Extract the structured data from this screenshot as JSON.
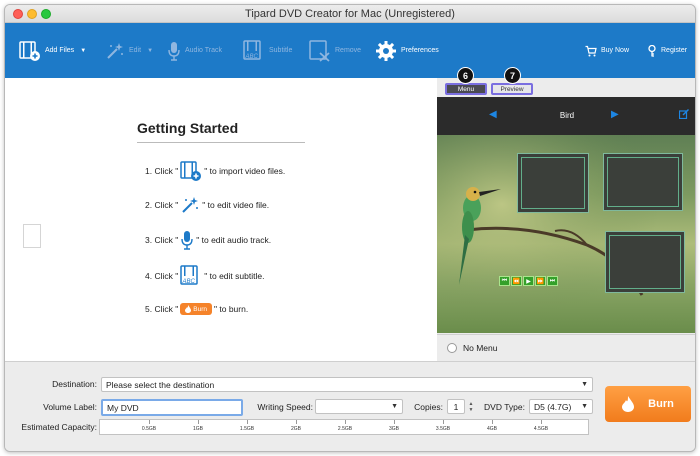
{
  "window": {
    "title": "Tipard DVD Creator for Mac (Unregistered)"
  },
  "toolbar": {
    "add_files": "Add Files",
    "edit": "Edit",
    "audio_track": "Audio Track",
    "subtitle": "Subtitle",
    "remove": "Remove",
    "preferences": "Preferences",
    "buy_now": "Buy Now",
    "register": "Register"
  },
  "getting_started": {
    "title": "Getting Started",
    "steps": [
      {
        "prefix": "1. Click \"",
        "suffix": "\" to import video files.",
        "icon": "add-video-icon"
      },
      {
        "prefix": "2. Click \"",
        "suffix": "\" to edit video file.",
        "icon": "magic-wand-icon"
      },
      {
        "prefix": "3. Click \"",
        "suffix": "\" to edit audio track.",
        "icon": "microphone-icon"
      },
      {
        "prefix": "4. Click \"",
        "suffix": "\" to edit subtitle.",
        "icon": "subtitle-icon"
      },
      {
        "prefix": "5. Click \"",
        "suffix": "\" to burn.",
        "icon": "burn-chip"
      }
    ],
    "burn_chip_label": "Burn"
  },
  "preview_panel": {
    "tabs": [
      {
        "label": "Menu",
        "badge": "6",
        "active": true
      },
      {
        "label": "Preview",
        "badge": "7",
        "active": false
      }
    ],
    "template_name": "Bird",
    "no_menu_label": "No Menu",
    "no_menu_checked": false
  },
  "bottom": {
    "destination_label": "Destination:",
    "destination_value": "Please select the destination",
    "volume_label_label": "Volume Label:",
    "volume_label_value": "My DVD",
    "writing_speed_label": "Writing Speed:",
    "writing_speed_value": "",
    "copies_label": "Copies:",
    "copies_value": "1",
    "dvd_type_label": "DVD Type:",
    "dvd_type_value": "D5 (4.7G)",
    "estimated_capacity_label": "Estimated Capacity:",
    "capacity_ticks": [
      "0.5GB",
      "1GB",
      "1.5GB",
      "2GB",
      "2.5GB",
      "3GB",
      "3.5GB",
      "4GB",
      "4.5GB"
    ],
    "burn_label": "Burn"
  },
  "colors": {
    "toolbar_bg": "#1d7ac8",
    "accent_orange": "#f5832a",
    "tab_outline": "#7a6ee0"
  }
}
